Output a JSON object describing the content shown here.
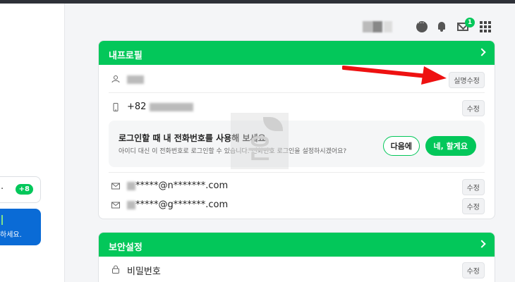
{
  "left": {
    "card": {
      "dot": "·",
      "badge": "+8"
    },
    "notice": {
      "text": "하세요."
    }
  },
  "header": {
    "mail_badge": "1",
    "icons": [
      "chat-icon",
      "bell-icon",
      "mail-icon",
      "apps-grid-icon"
    ]
  },
  "profile": {
    "title": "내프로필",
    "name_edit_label": "실명수정",
    "phone_prefix": "+82",
    "phone_edit_label": "수정",
    "suggest_title": "로그인할 때 내 전화번호를 사용해 보세요",
    "suggest_sub": "아이디 대신 이 전화번호로 로그인할 수 있습니다. 전화번호 로그인을 설정하시겠어요?",
    "later_label": "다음에",
    "yes_label": "네, 할게요",
    "emails": [
      {
        "value": "*****@n*******.com",
        "edit_label": "수정"
      },
      {
        "value": "*****@g*******.com",
        "edit_label": "수정"
      }
    ]
  },
  "security": {
    "title": "보안설정",
    "password_label": "비밀번호",
    "password_edit_label": "수정"
  },
  "colors": {
    "brand_green": "#03c75a",
    "annotation_red": "#e11",
    "blue": "#0a6bd6"
  }
}
